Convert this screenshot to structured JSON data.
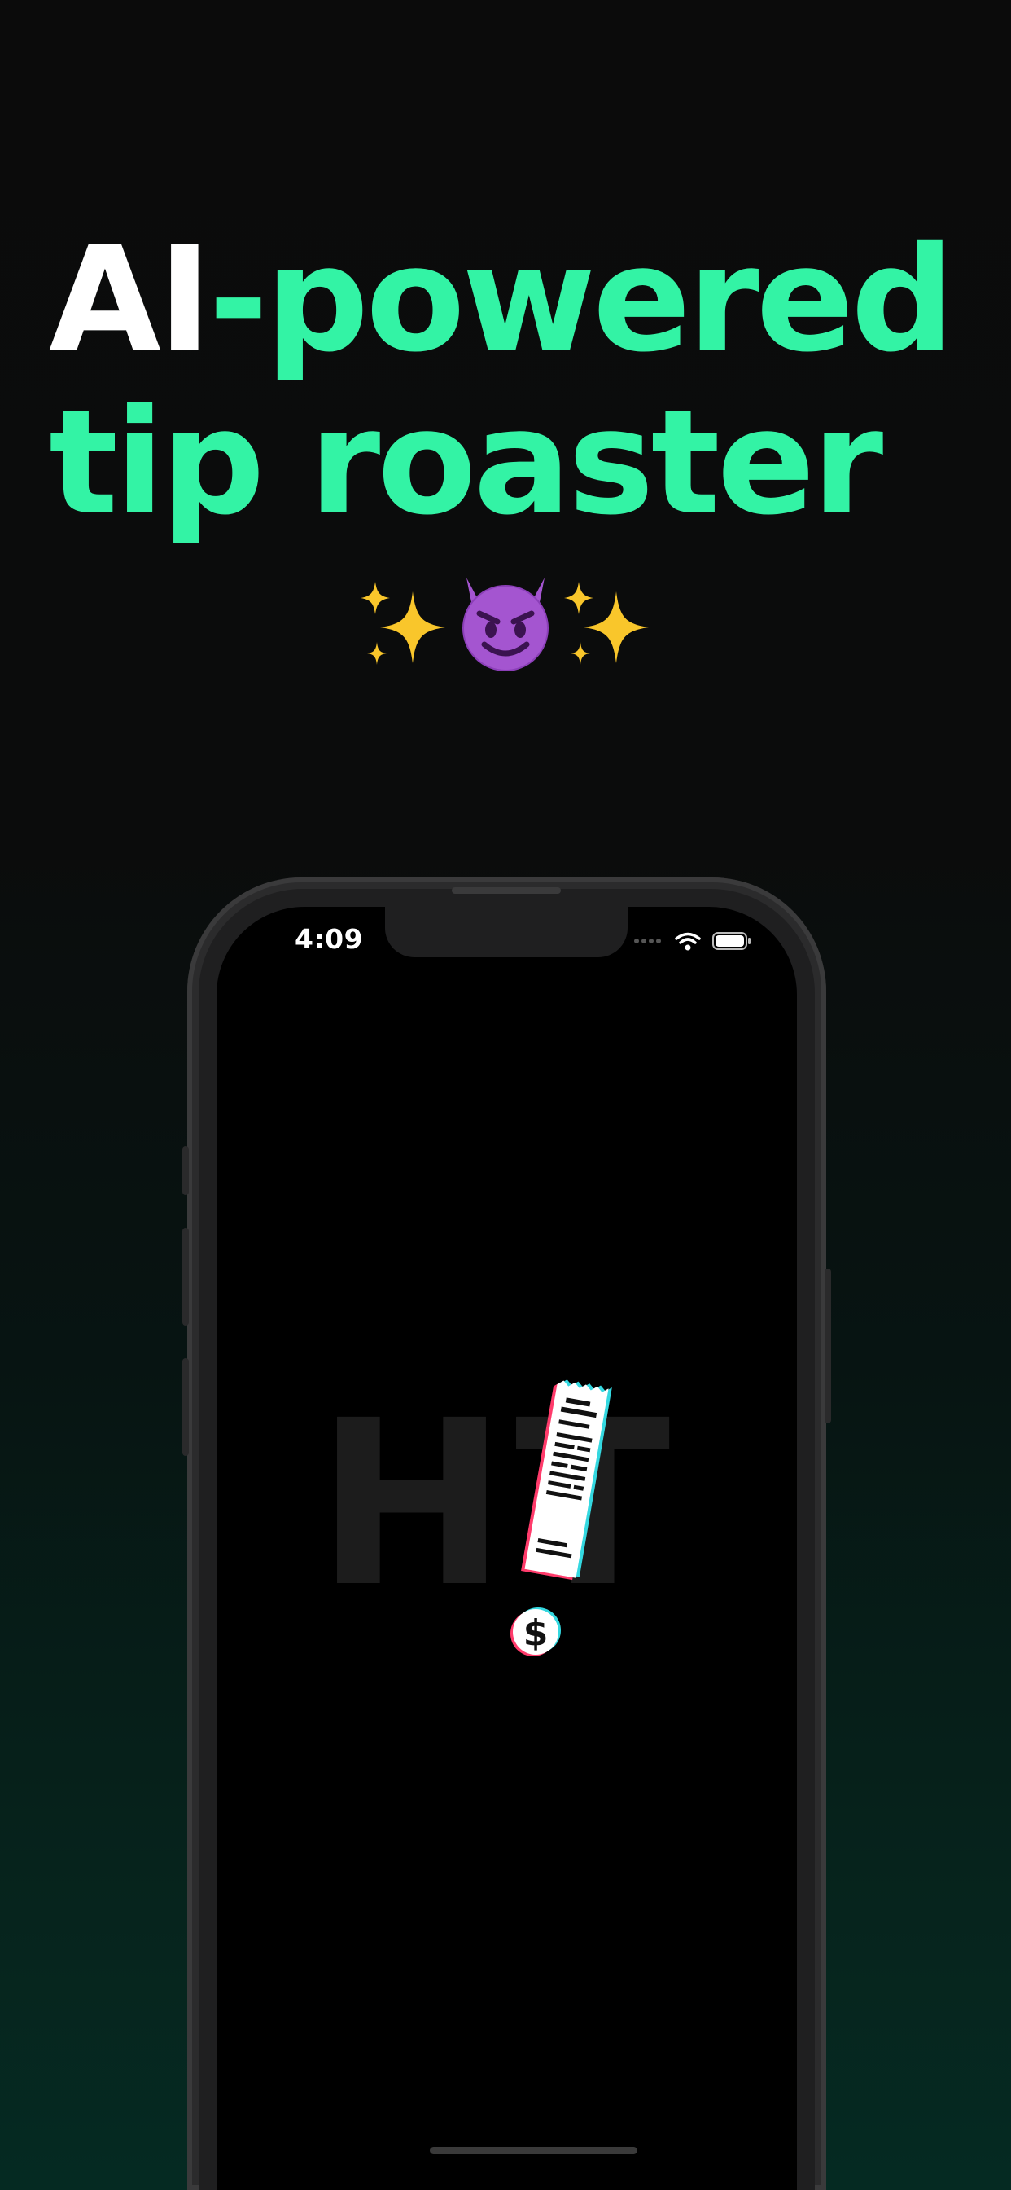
{
  "headline": {
    "line1_white": "AI",
    "line1_green": "-powered",
    "line2_green": "tip roaster"
  },
  "emoji_row": [
    "sparkles-icon",
    "smiling-devil-icon",
    "sparkles-icon"
  ],
  "phone": {
    "status_bar": {
      "time": "4:09",
      "icons": [
        "signal-dots-icon",
        "wifi-icon",
        "battery-icon"
      ]
    },
    "splash": {
      "background_letters": "HT",
      "logo": "receipt-exclamation-logo",
      "coin_symbol": "$"
    }
  },
  "colors": {
    "accent_green": "#33f3a5",
    "background_top": "#0b0b0b",
    "background_bottom": "#052a22",
    "phone_frame": "#2b2b2c",
    "screen": "#000000"
  }
}
